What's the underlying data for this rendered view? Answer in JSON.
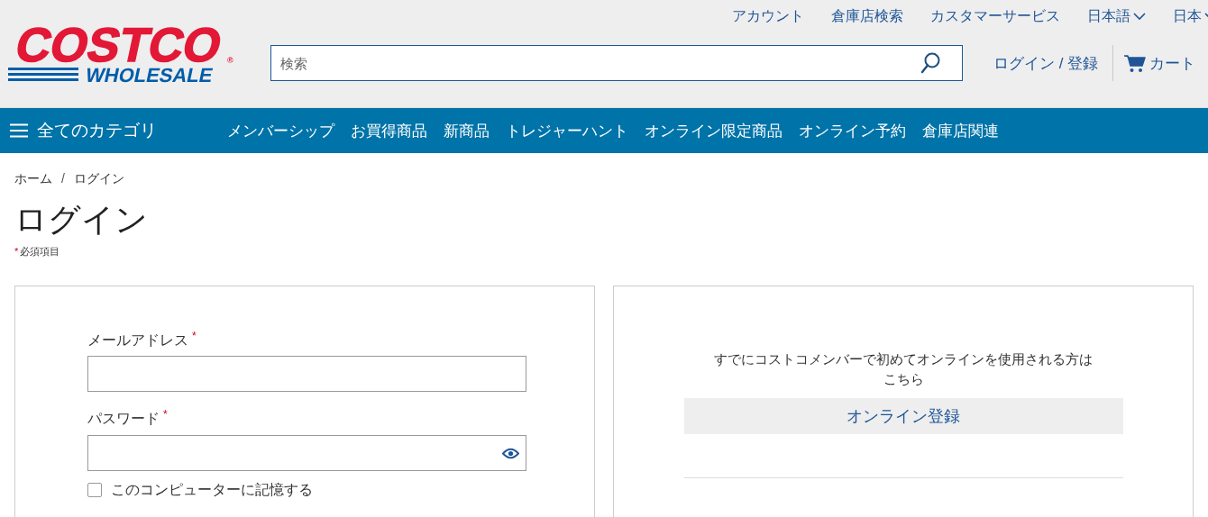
{
  "header": {
    "logo": {
      "top": "COSTCO",
      "bottom": "WHOLESALE",
      "mark": "®"
    },
    "top_links": [
      {
        "label": "アカウント",
        "kind": "link"
      },
      {
        "label": "倉庫店検索",
        "kind": "link"
      },
      {
        "label": "カスタマーサービス",
        "kind": "link"
      },
      {
        "label": "日本語",
        "kind": "dropdown"
      },
      {
        "label": "日本",
        "kind": "dropdown"
      }
    ],
    "search": {
      "placeholder": "検索"
    },
    "login_link": "ログイン / 登録",
    "cart": "カート"
  },
  "nav": {
    "all_categories": "全てのカテゴリ",
    "items": [
      "メンバーシップ",
      "お買得商品",
      "新商品",
      "トレジャーハント",
      "オンライン限定商品",
      "オンライン予約",
      "倉庫店関連"
    ]
  },
  "breadcrumb": [
    "ホーム",
    "ログイン"
  ],
  "breadcrumb_separator": "/",
  "title": "ログイン",
  "required_note": {
    "mark": "*",
    "text": "必須項目"
  },
  "login_form": {
    "fields": [
      {
        "label": "メールアドレス",
        "required": true,
        "kind": "text"
      },
      {
        "label": "パスワード",
        "required": true,
        "kind": "password"
      }
    ],
    "remember": {
      "label": "このコンピューターに記憶する",
      "checked": false
    }
  },
  "register_panel": {
    "text": "すでにコストコメンバーで初めてオンラインを使用される方はこちら",
    "button": "オンライン登録"
  }
}
